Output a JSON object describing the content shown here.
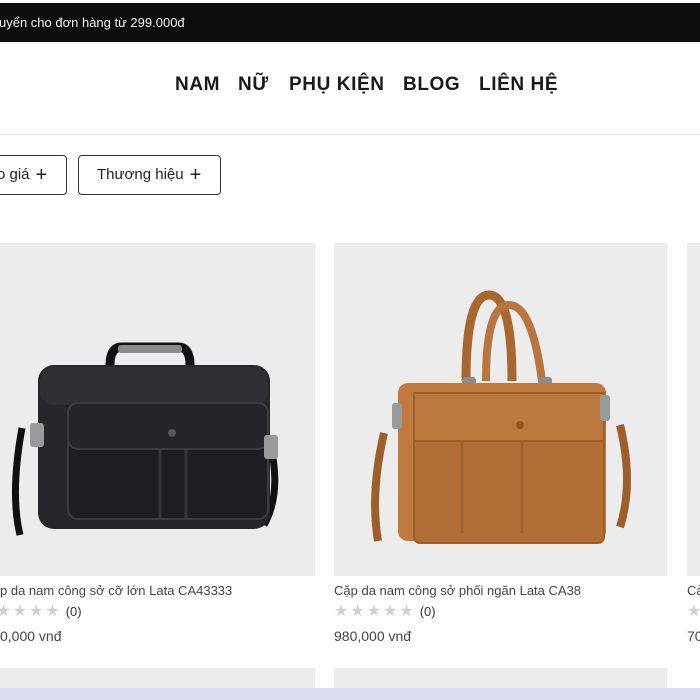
{
  "announcement": "uyển cho đơn hàng từ 299.000đ",
  "nav": {
    "items": [
      "NAM",
      "NỮ",
      "PHỤ KIỆN",
      "BLOG",
      "LIÊN HỆ"
    ]
  },
  "filters": {
    "price_label": "o giá",
    "brand_label": "Thương hiệu",
    "plus_symbol": "+"
  },
  "products": [
    {
      "name": "p da nam công sở cỡ lớn Lata CA43333",
      "stars": "★★★★★",
      "review_count": "(0)",
      "price": "0,000 vnđ",
      "bag_color": "#1f2126"
    },
    {
      "name": "Cặp da nam công sở phối ngăn Lata CA38",
      "stars": "★★★★★",
      "review_count": "(0)",
      "price": "980,000 vnđ",
      "bag_color": "#b8753e"
    },
    {
      "name": "Cả",
      "stars": "★",
      "review_count": "",
      "price": "70",
      "bag_color": ""
    }
  ]
}
